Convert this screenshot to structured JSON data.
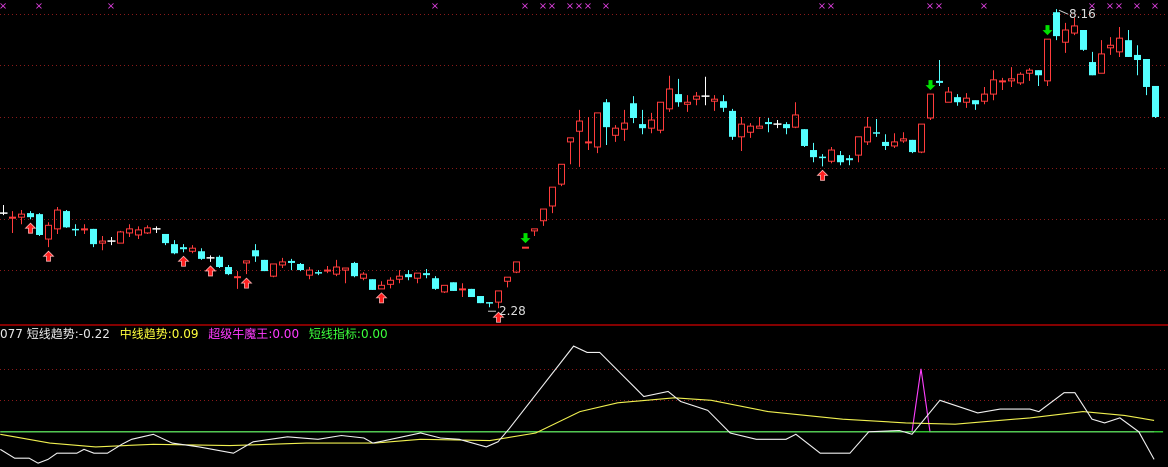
{
  "colors": {
    "up": "#ff3c3c",
    "down": "#54ffff",
    "flat": "#ffffff",
    "up_signal": "#ff2020",
    "down_signal": "#00e000",
    "marker": "#e040e0",
    "grid": "#8a1a1a",
    "separator": "#b00000",
    "white_line": "#f0f0f0",
    "yellow_line": "#f0f050",
    "magenta_line": "#ff40ff",
    "green_line": "#40ff40"
  },
  "indicator_legend": {
    "prefix": "077",
    "items": [
      {
        "label": "短线趋势",
        "value": "-0.22",
        "color": "white"
      },
      {
        "label": "中线趋势",
        "value": "0.09",
        "color": "yellow"
      },
      {
        "label": "超级牛魔王",
        "value": "0.00",
        "color": "magenta"
      },
      {
        "label": "短线指标",
        "value": "0.00",
        "color": "green"
      }
    ]
  },
  "chart_data": [
    {
      "type": "candlestick",
      "title": "",
      "ylim": [
        1.95,
        8.34
      ],
      "gridlines": [
        8.06,
        7.06,
        6.04,
        5.04,
        4.03,
        3.03
      ],
      "high_label": {
        "text": "8.16",
        "index": 117,
        "price": 8.16
      },
      "low_label": {
        "text": "2.28",
        "index": 55,
        "price": 2.28
      },
      "candles_ohlc": [
        [
          4.15,
          4.31,
          4.11,
          4.15
        ],
        [
          4.05,
          4.19,
          3.76,
          4.07
        ],
        [
          4.07,
          4.21,
          3.93,
          4.13
        ],
        [
          4.15,
          4.19,
          4.03,
          4.07
        ],
        [
          4.13,
          4.15,
          3.7,
          3.72
        ],
        [
          3.64,
          3.97,
          3.48,
          3.91
        ],
        [
          3.84,
          4.27,
          3.74,
          4.21
        ],
        [
          4.19,
          4.21,
          3.86,
          3.87
        ],
        [
          3.84,
          3.93,
          3.7,
          3.82
        ],
        [
          3.82,
          3.93,
          3.74,
          3.84
        ],
        [
          3.84,
          3.84,
          3.48,
          3.54
        ],
        [
          3.56,
          3.7,
          3.42,
          3.6
        ],
        [
          3.6,
          3.68,
          3.52,
          3.6
        ],
        [
          3.56,
          3.8,
          3.56,
          3.78
        ],
        [
          3.76,
          3.93,
          3.68,
          3.84
        ],
        [
          3.72,
          3.89,
          3.64,
          3.82
        ],
        [
          3.76,
          3.91,
          3.74,
          3.86
        ],
        [
          3.84,
          3.89,
          3.76,
          3.84
        ],
        [
          3.74,
          3.74,
          3.52,
          3.56
        ],
        [
          3.54,
          3.62,
          3.34,
          3.36
        ],
        [
          3.48,
          3.54,
          3.38,
          3.44
        ],
        [
          3.4,
          3.52,
          3.36,
          3.46
        ],
        [
          3.4,
          3.46,
          3.23,
          3.25
        ],
        [
          3.27,
          3.32,
          3.19,
          3.27
        ],
        [
          3.29,
          3.32,
          3.07,
          3.09
        ],
        [
          3.09,
          3.13,
          2.93,
          2.95
        ],
        [
          2.89,
          3.01,
          2.66,
          2.9
        ],
        [
          3.17,
          3.21,
          2.95,
          3.21
        ],
        [
          3.42,
          3.54,
          3.19,
          3.3
        ],
        [
          3.23,
          3.23,
          3.01,
          3.01
        ],
        [
          2.91,
          3.15,
          2.89,
          3.15
        ],
        [
          3.13,
          3.27,
          3.07,
          3.19
        ],
        [
          3.21,
          3.25,
          3.03,
          3.17
        ],
        [
          3.15,
          3.17,
          3.01,
          3.03
        ],
        [
          2.93,
          3.09,
          2.85,
          3.03
        ],
        [
          2.99,
          3.03,
          2.93,
          2.97
        ],
        [
          3.02,
          3.11,
          2.97,
          3.03
        ],
        [
          2.95,
          3.23,
          2.91,
          3.09
        ],
        [
          3.03,
          3.07,
          2.77,
          3.07
        ],
        [
          3.17,
          3.19,
          2.89,
          2.91
        ],
        [
          2.87,
          2.99,
          2.83,
          2.95
        ],
        [
          2.85,
          2.85,
          2.64,
          2.64
        ],
        [
          2.66,
          2.81,
          2.66,
          2.73
        ],
        [
          2.75,
          2.89,
          2.67,
          2.83
        ],
        [
          2.85,
          3.03,
          2.77,
          2.91
        ],
        [
          2.95,
          3.03,
          2.83,
          2.89
        ],
        [
          2.87,
          2.97,
          2.77,
          2.97
        ],
        [
          2.97,
          3.05,
          2.87,
          2.93
        ],
        [
          2.87,
          2.91,
          2.64,
          2.66
        ],
        [
          2.6,
          2.73,
          2.58,
          2.73
        ],
        [
          2.79,
          2.79,
          2.62,
          2.62
        ],
        [
          2.65,
          2.77,
          2.5,
          2.66
        ],
        [
          2.66,
          2.66,
          2.5,
          2.5
        ],
        [
          2.52,
          2.52,
          2.38,
          2.38
        ],
        [
          2.4,
          2.4,
          2.3,
          2.38
        ],
        [
          2.4,
          2.62,
          2.28,
          2.62
        ],
        [
          2.81,
          2.89,
          2.69,
          2.89
        ],
        [
          2.99,
          3.19,
          2.97,
          3.19
        ],
        [
          3.47,
          3.48,
          3.47,
          3.48
        ],
        [
          3.8,
          3.84,
          3.7,
          3.84
        ],
        [
          4.0,
          4.23,
          3.9,
          4.23
        ],
        [
          4.29,
          4.66,
          4.15,
          4.66
        ],
        [
          4.72,
          5.11,
          4.68,
          5.11
        ],
        [
          5.55,
          5.63,
          5.11,
          5.63
        ],
        [
          5.76,
          6.18,
          5.06,
          5.96
        ],
        [
          5.54,
          6.04,
          5.39,
          5.55
        ],
        [
          5.45,
          6.12,
          5.33,
          6.12
        ],
        [
          6.33,
          6.39,
          5.49,
          5.84
        ],
        [
          5.68,
          5.88,
          5.55,
          5.82
        ],
        [
          5.8,
          6.18,
          5.57,
          5.92
        ],
        [
          6.31,
          6.45,
          5.92,
          6.02
        ],
        [
          5.9,
          6.18,
          5.7,
          5.82
        ],
        [
          5.82,
          6.12,
          5.72,
          5.98
        ],
        [
          5.78,
          6.33,
          5.72,
          6.33
        ],
        [
          6.2,
          6.85,
          6.14,
          6.59
        ],
        [
          6.49,
          6.79,
          6.24,
          6.33
        ],
        [
          6.29,
          6.47,
          6.14,
          6.33
        ],
        [
          6.39,
          6.53,
          6.27,
          6.45
        ],
        [
          6.45,
          6.83,
          6.27,
          6.45
        ],
        [
          6.35,
          6.47,
          6.16,
          6.39
        ],
        [
          6.35,
          6.47,
          6.14,
          6.22
        ],
        [
          6.16,
          6.2,
          5.59,
          5.65
        ],
        [
          5.65,
          6.04,
          5.37,
          5.9
        ],
        [
          5.74,
          5.92,
          5.63,
          5.86
        ],
        [
          5.82,
          6.04,
          5.82,
          5.86
        ],
        [
          5.94,
          6.02,
          5.74,
          5.9
        ],
        [
          5.9,
          5.98,
          5.82,
          5.9
        ],
        [
          5.9,
          5.94,
          5.7,
          5.82
        ],
        [
          5.84,
          6.33,
          5.82,
          6.08
        ],
        [
          5.8,
          5.8,
          5.45,
          5.47
        ],
        [
          5.39,
          5.53,
          5.15,
          5.25
        ],
        [
          5.26,
          5.31,
          5.07,
          5.25
        ],
        [
          5.17,
          5.45,
          5.13,
          5.39
        ],
        [
          5.29,
          5.37,
          5.09,
          5.15
        ],
        [
          5.23,
          5.29,
          5.09,
          5.19
        ],
        [
          5.29,
          5.65,
          5.15,
          5.65
        ],
        [
          5.55,
          6.04,
          5.49,
          5.84
        ],
        [
          5.74,
          6.0,
          5.65,
          5.72
        ],
        [
          5.55,
          5.7,
          5.39,
          5.47
        ],
        [
          5.47,
          5.72,
          5.43,
          5.55
        ],
        [
          5.57,
          5.74,
          5.53,
          5.61
        ],
        [
          5.59,
          5.59,
          5.33,
          5.35
        ],
        [
          5.35,
          5.9,
          5.33,
          5.9
        ],
        [
          6.02,
          6.49,
          5.98,
          6.49
        ],
        [
          6.75,
          7.16,
          6.65,
          6.71
        ],
        [
          6.33,
          6.63,
          6.33,
          6.53
        ],
        [
          6.43,
          6.49,
          6.26,
          6.33
        ],
        [
          6.33,
          6.51,
          6.22,
          6.41
        ],
        [
          6.37,
          6.37,
          6.18,
          6.29
        ],
        [
          6.35,
          6.63,
          6.29,
          6.49
        ],
        [
          6.49,
          6.96,
          6.37,
          6.77
        ],
        [
          6.74,
          6.81,
          6.57,
          6.75
        ],
        [
          6.75,
          7.02,
          6.63,
          6.79
        ],
        [
          6.71,
          6.92,
          6.67,
          6.88
        ],
        [
          6.9,
          7.0,
          6.75,
          6.96
        ],
        [
          6.96,
          6.96,
          6.65,
          6.86
        ],
        [
          6.75,
          7.57,
          6.65,
          7.57
        ],
        [
          8.1,
          8.16,
          7.55,
          7.63
        ],
        [
          7.51,
          7.89,
          7.3,
          7.75
        ],
        [
          7.69,
          7.99,
          7.65,
          7.83
        ],
        [
          7.75,
          7.75,
          7.34,
          7.36
        ],
        [
          7.12,
          7.32,
          6.86,
          6.86
        ],
        [
          6.9,
          7.55,
          6.9,
          7.28
        ],
        [
          7.4,
          7.61,
          7.26,
          7.45
        ],
        [
          7.32,
          7.81,
          7.22,
          7.59
        ],
        [
          7.55,
          7.75,
          7.22,
          7.22
        ],
        [
          7.26,
          7.45,
          6.86,
          7.16
        ],
        [
          7.18,
          7.18,
          6.47,
          6.63
        ],
        [
          6.65,
          6.65,
          6.02,
          6.04
        ]
      ],
      "buy_signals": [
        3,
        5,
        20,
        23,
        27,
        42,
        55,
        91
      ],
      "sell_signals": [
        58,
        103,
        116
      ],
      "top_markers": [
        0,
        4,
        12,
        48,
        58,
        60,
        61,
        63,
        64,
        65,
        67,
        91,
        92,
        103,
        104,
        109,
        121,
        123,
        124,
        126,
        128
      ]
    },
    {
      "type": "line",
      "ylim": [
        -0.28,
        0.84
      ],
      "gridlines": [
        0.5,
        0.25
      ],
      "series": [
        {
          "name": "短线趋势",
          "color": "white",
          "points": [
            [
              -0.3,
              -0.14
            ],
            [
              1.3,
              -0.21
            ],
            [
              2.9,
              -0.21
            ],
            [
              3.9,
              -0.25
            ],
            [
              5,
              -0.22
            ],
            [
              6,
              -0.17
            ],
            [
              8.2,
              -0.17
            ],
            [
              9,
              -0.14
            ],
            [
              10.1,
              -0.17
            ],
            [
              11.6,
              -0.17
            ],
            [
              13.2,
              -0.1
            ],
            [
              14.3,
              -0.06
            ],
            [
              16.7,
              -0.02
            ],
            [
              18.8,
              -0.09
            ],
            [
              21.8,
              -0.12
            ],
            [
              25.6,
              -0.17
            ],
            [
              27.8,
              -0.08
            ],
            [
              31.6,
              -0.04
            ],
            [
              35,
              -0.06
            ],
            [
              37.6,
              -0.03
            ],
            [
              40.1,
              -0.05
            ],
            [
              41.1,
              -0.09
            ],
            [
              46.4,
              -0.01
            ],
            [
              48.6,
              -0.05
            ],
            [
              50.7,
              -0.06
            ],
            [
              53.7,
              -0.12
            ],
            [
              55,
              -0.08
            ],
            [
              56.2,
              0.02
            ],
            [
              63.4,
              0.68
            ],
            [
              64.9,
              0.63
            ],
            [
              66.3,
              0.63
            ],
            [
              69.1,
              0.43
            ],
            [
              71.2,
              0.28
            ],
            [
              73.9,
              0.32
            ],
            [
              75.3,
              0.24
            ],
            [
              78.3,
              0.17
            ],
            [
              80.8,
              -0.01
            ],
            [
              83.7,
              -0.06
            ],
            [
              87,
              -0.06
            ],
            [
              88.1,
              -0.02
            ],
            [
              90.8,
              -0.17
            ],
            [
              94.1,
              -0.17
            ],
            [
              96.2,
              0
            ],
            [
              99.6,
              0.01
            ],
            [
              101,
              -0.02
            ],
            [
              104.1,
              0.25
            ],
            [
              108.3,
              0.15
            ],
            [
              110.8,
              0.18
            ],
            [
              114.1,
              0.18
            ],
            [
              115.1,
              0.16
            ],
            [
              117.9,
              0.31
            ],
            [
              119.1,
              0.31
            ],
            [
              121,
              0.1
            ],
            [
              122.4,
              0.07
            ],
            [
              124.1,
              0.11
            ],
            [
              126.2,
              0
            ],
            [
              127.9,
              -0.22
            ]
          ]
        },
        {
          "name": "中线趋势",
          "color": "yellow",
          "points": [
            [
              -0.3,
              -0.02
            ],
            [
              5.2,
              -0.09
            ],
            [
              10.3,
              -0.12
            ],
            [
              16.7,
              -0.1
            ],
            [
              25.2,
              -0.11
            ],
            [
              33.7,
              -0.09
            ],
            [
              41.3,
              -0.09
            ],
            [
              46.4,
              -0.06
            ],
            [
              54.1,
              -0.07
            ],
            [
              59.2,
              -0.01
            ],
            [
              64.1,
              0.16
            ],
            [
              68.3,
              0.23
            ],
            [
              74.6,
              0.27
            ],
            [
              78.7,
              0.25
            ],
            [
              85,
              0.16
            ],
            [
              93.3,
              0.1
            ],
            [
              100.3,
              0.07
            ],
            [
              105.8,
              0.06
            ],
            [
              114.1,
              0.11
            ],
            [
              120,
              0.16
            ],
            [
              124.6,
              0.13
            ],
            [
              127.9,
              0.09
            ]
          ]
        },
        {
          "name": "超级牛魔王",
          "color": "magenta",
          "points": [
            [
              -0.3,
              0
            ],
            [
              101,
              0
            ],
            [
              102,
              0.5
            ],
            [
              103,
              0
            ],
            [
              127.9,
              0
            ]
          ]
        },
        {
          "name": "短线指标",
          "color": "green",
          "points": [
            [
              -0.3,
              0
            ],
            [
              128.9,
              0
            ]
          ]
        }
      ]
    }
  ]
}
